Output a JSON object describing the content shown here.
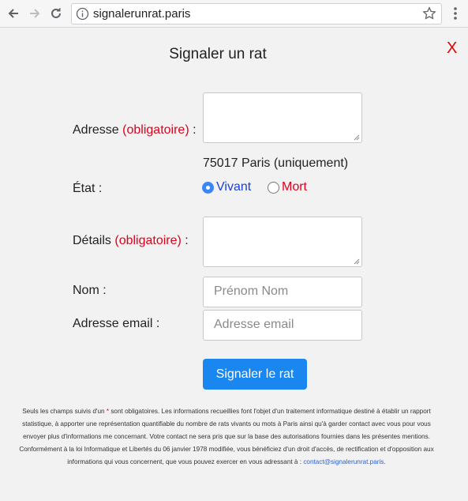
{
  "browser": {
    "url": "signalerunrat.paris"
  },
  "page": {
    "title": "Signaler un rat",
    "close_label": "X"
  },
  "form": {
    "address": {
      "label": "Adresse",
      "required": "(obligatoire)",
      "suffix": " :",
      "hint": "75017 Paris (uniquement)"
    },
    "state": {
      "label": "État :",
      "options": [
        {
          "label": "Vivant",
          "selected": true
        },
        {
          "label": "Mort",
          "selected": false
        }
      ]
    },
    "details": {
      "label": "Détails",
      "required": "(obligatoire)",
      "suffix": " :"
    },
    "name": {
      "label": "Nom :",
      "placeholder": "Prénom Nom"
    },
    "email": {
      "label": "Adresse email :",
      "placeholder": "Adresse email"
    },
    "submit_label": "Signaler le rat"
  },
  "footer": {
    "text_before_star": "Seuls les champs suivis d'un ",
    "star": "*",
    "text_after_star": " sont obligatoires. Les informations recueillies font l'objet d'un traitement informatique destiné à établir un rapport statistique, à apporter une représentation quantifiable du nombre de rats vivants ou mots à Paris ainsi qu'à garder contact avec vous pour vous envoyer plus d'informations me concernant. Votre contact ne sera pris que sur la base des autorisations fournies dans les présentes mentions. Conformément à la loi Informatique et Libertés du 06 janvier 1978 modifiée, vous bénéficiez d'un droit d'accès, de rectification et d'opposition aux informations qui vous concernent, que vous pouvez exercer en vous adressant à : ",
    "email": "contact@signalerunrat.paris",
    "text_end": "."
  },
  "colors": {
    "required": "#e0001a",
    "accent": "#1a86f0",
    "radio_selected": "#3b86f7",
    "vivant": "#1d3fd6",
    "mort": "#e0001a"
  }
}
